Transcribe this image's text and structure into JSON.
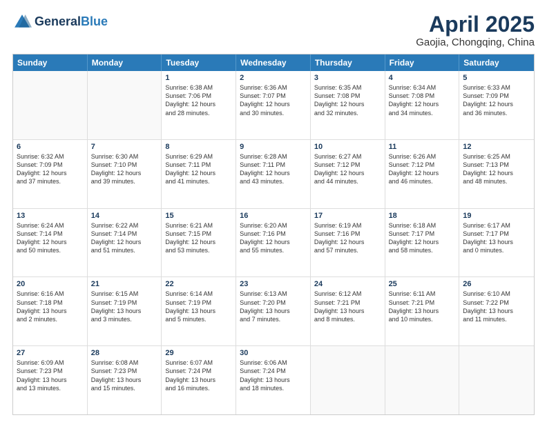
{
  "header": {
    "logo_general": "General",
    "logo_blue": "Blue",
    "title": "April 2025",
    "subtitle": "Gaojia, Chongqing, China"
  },
  "weekdays": [
    "Sunday",
    "Monday",
    "Tuesday",
    "Wednesday",
    "Thursday",
    "Friday",
    "Saturday"
  ],
  "rows": [
    [
      {
        "day": "",
        "info": ""
      },
      {
        "day": "",
        "info": ""
      },
      {
        "day": "1",
        "info": "Sunrise: 6:38 AM\nSunset: 7:06 PM\nDaylight: 12 hours\nand 28 minutes."
      },
      {
        "day": "2",
        "info": "Sunrise: 6:36 AM\nSunset: 7:07 PM\nDaylight: 12 hours\nand 30 minutes."
      },
      {
        "day": "3",
        "info": "Sunrise: 6:35 AM\nSunset: 7:08 PM\nDaylight: 12 hours\nand 32 minutes."
      },
      {
        "day": "4",
        "info": "Sunrise: 6:34 AM\nSunset: 7:08 PM\nDaylight: 12 hours\nand 34 minutes."
      },
      {
        "day": "5",
        "info": "Sunrise: 6:33 AM\nSunset: 7:09 PM\nDaylight: 12 hours\nand 36 minutes."
      }
    ],
    [
      {
        "day": "6",
        "info": "Sunrise: 6:32 AM\nSunset: 7:09 PM\nDaylight: 12 hours\nand 37 minutes."
      },
      {
        "day": "7",
        "info": "Sunrise: 6:30 AM\nSunset: 7:10 PM\nDaylight: 12 hours\nand 39 minutes."
      },
      {
        "day": "8",
        "info": "Sunrise: 6:29 AM\nSunset: 7:11 PM\nDaylight: 12 hours\nand 41 minutes."
      },
      {
        "day": "9",
        "info": "Sunrise: 6:28 AM\nSunset: 7:11 PM\nDaylight: 12 hours\nand 43 minutes."
      },
      {
        "day": "10",
        "info": "Sunrise: 6:27 AM\nSunset: 7:12 PM\nDaylight: 12 hours\nand 44 minutes."
      },
      {
        "day": "11",
        "info": "Sunrise: 6:26 AM\nSunset: 7:12 PM\nDaylight: 12 hours\nand 46 minutes."
      },
      {
        "day": "12",
        "info": "Sunrise: 6:25 AM\nSunset: 7:13 PM\nDaylight: 12 hours\nand 48 minutes."
      }
    ],
    [
      {
        "day": "13",
        "info": "Sunrise: 6:24 AM\nSunset: 7:14 PM\nDaylight: 12 hours\nand 50 minutes."
      },
      {
        "day": "14",
        "info": "Sunrise: 6:22 AM\nSunset: 7:14 PM\nDaylight: 12 hours\nand 51 minutes."
      },
      {
        "day": "15",
        "info": "Sunrise: 6:21 AM\nSunset: 7:15 PM\nDaylight: 12 hours\nand 53 minutes."
      },
      {
        "day": "16",
        "info": "Sunrise: 6:20 AM\nSunset: 7:16 PM\nDaylight: 12 hours\nand 55 minutes."
      },
      {
        "day": "17",
        "info": "Sunrise: 6:19 AM\nSunset: 7:16 PM\nDaylight: 12 hours\nand 57 minutes."
      },
      {
        "day": "18",
        "info": "Sunrise: 6:18 AM\nSunset: 7:17 PM\nDaylight: 12 hours\nand 58 minutes."
      },
      {
        "day": "19",
        "info": "Sunrise: 6:17 AM\nSunset: 7:17 PM\nDaylight: 13 hours\nand 0 minutes."
      }
    ],
    [
      {
        "day": "20",
        "info": "Sunrise: 6:16 AM\nSunset: 7:18 PM\nDaylight: 13 hours\nand 2 minutes."
      },
      {
        "day": "21",
        "info": "Sunrise: 6:15 AM\nSunset: 7:19 PM\nDaylight: 13 hours\nand 3 minutes."
      },
      {
        "day": "22",
        "info": "Sunrise: 6:14 AM\nSunset: 7:19 PM\nDaylight: 13 hours\nand 5 minutes."
      },
      {
        "day": "23",
        "info": "Sunrise: 6:13 AM\nSunset: 7:20 PM\nDaylight: 13 hours\nand 7 minutes."
      },
      {
        "day": "24",
        "info": "Sunrise: 6:12 AM\nSunset: 7:21 PM\nDaylight: 13 hours\nand 8 minutes."
      },
      {
        "day": "25",
        "info": "Sunrise: 6:11 AM\nSunset: 7:21 PM\nDaylight: 13 hours\nand 10 minutes."
      },
      {
        "day": "26",
        "info": "Sunrise: 6:10 AM\nSunset: 7:22 PM\nDaylight: 13 hours\nand 11 minutes."
      }
    ],
    [
      {
        "day": "27",
        "info": "Sunrise: 6:09 AM\nSunset: 7:23 PM\nDaylight: 13 hours\nand 13 minutes."
      },
      {
        "day": "28",
        "info": "Sunrise: 6:08 AM\nSunset: 7:23 PM\nDaylight: 13 hours\nand 15 minutes."
      },
      {
        "day": "29",
        "info": "Sunrise: 6:07 AM\nSunset: 7:24 PM\nDaylight: 13 hours\nand 16 minutes."
      },
      {
        "day": "30",
        "info": "Sunrise: 6:06 AM\nSunset: 7:24 PM\nDaylight: 13 hours\nand 18 minutes."
      },
      {
        "day": "",
        "info": ""
      },
      {
        "day": "",
        "info": ""
      },
      {
        "day": "",
        "info": ""
      }
    ]
  ]
}
